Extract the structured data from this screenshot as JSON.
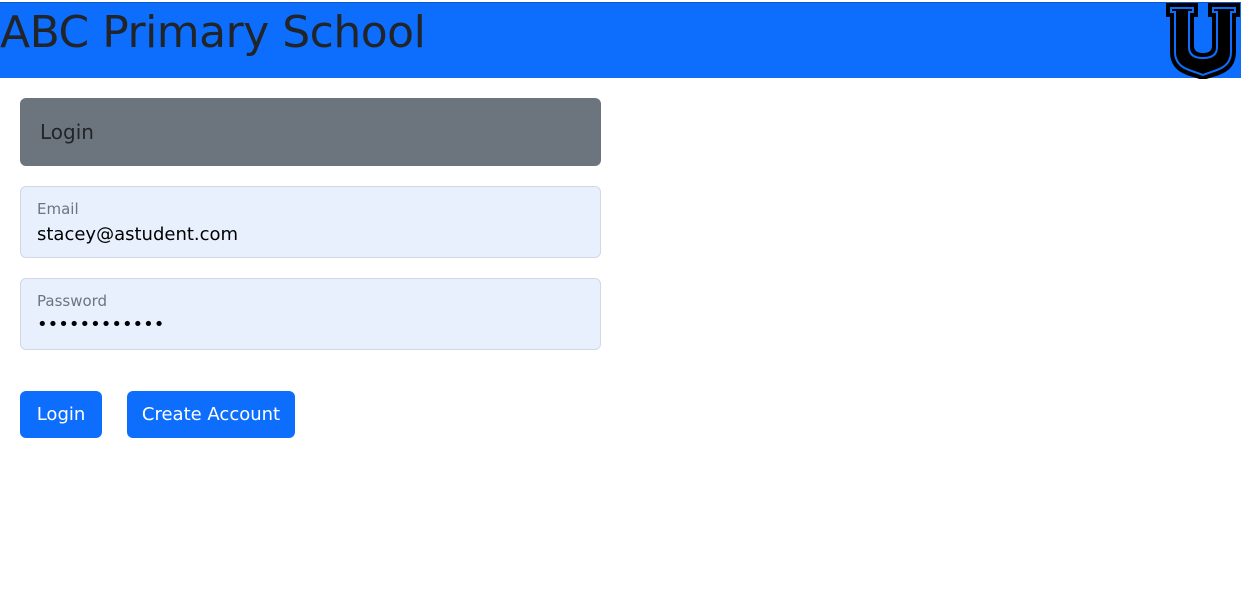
{
  "header": {
    "title": "ABC Primary School",
    "logo_icon": "u-shield-logo-icon",
    "background_color": "#0d6efd"
  },
  "login_card": {
    "title": "Login",
    "background_color": "#6c757d"
  },
  "form": {
    "email": {
      "label": "Email",
      "value": "stacey@astudent.com"
    },
    "password": {
      "label": "Password",
      "value": "••••••••••••"
    }
  },
  "buttons": {
    "login_label": "Login",
    "create_account_label": "Create Account",
    "color": "#0d6efd"
  }
}
